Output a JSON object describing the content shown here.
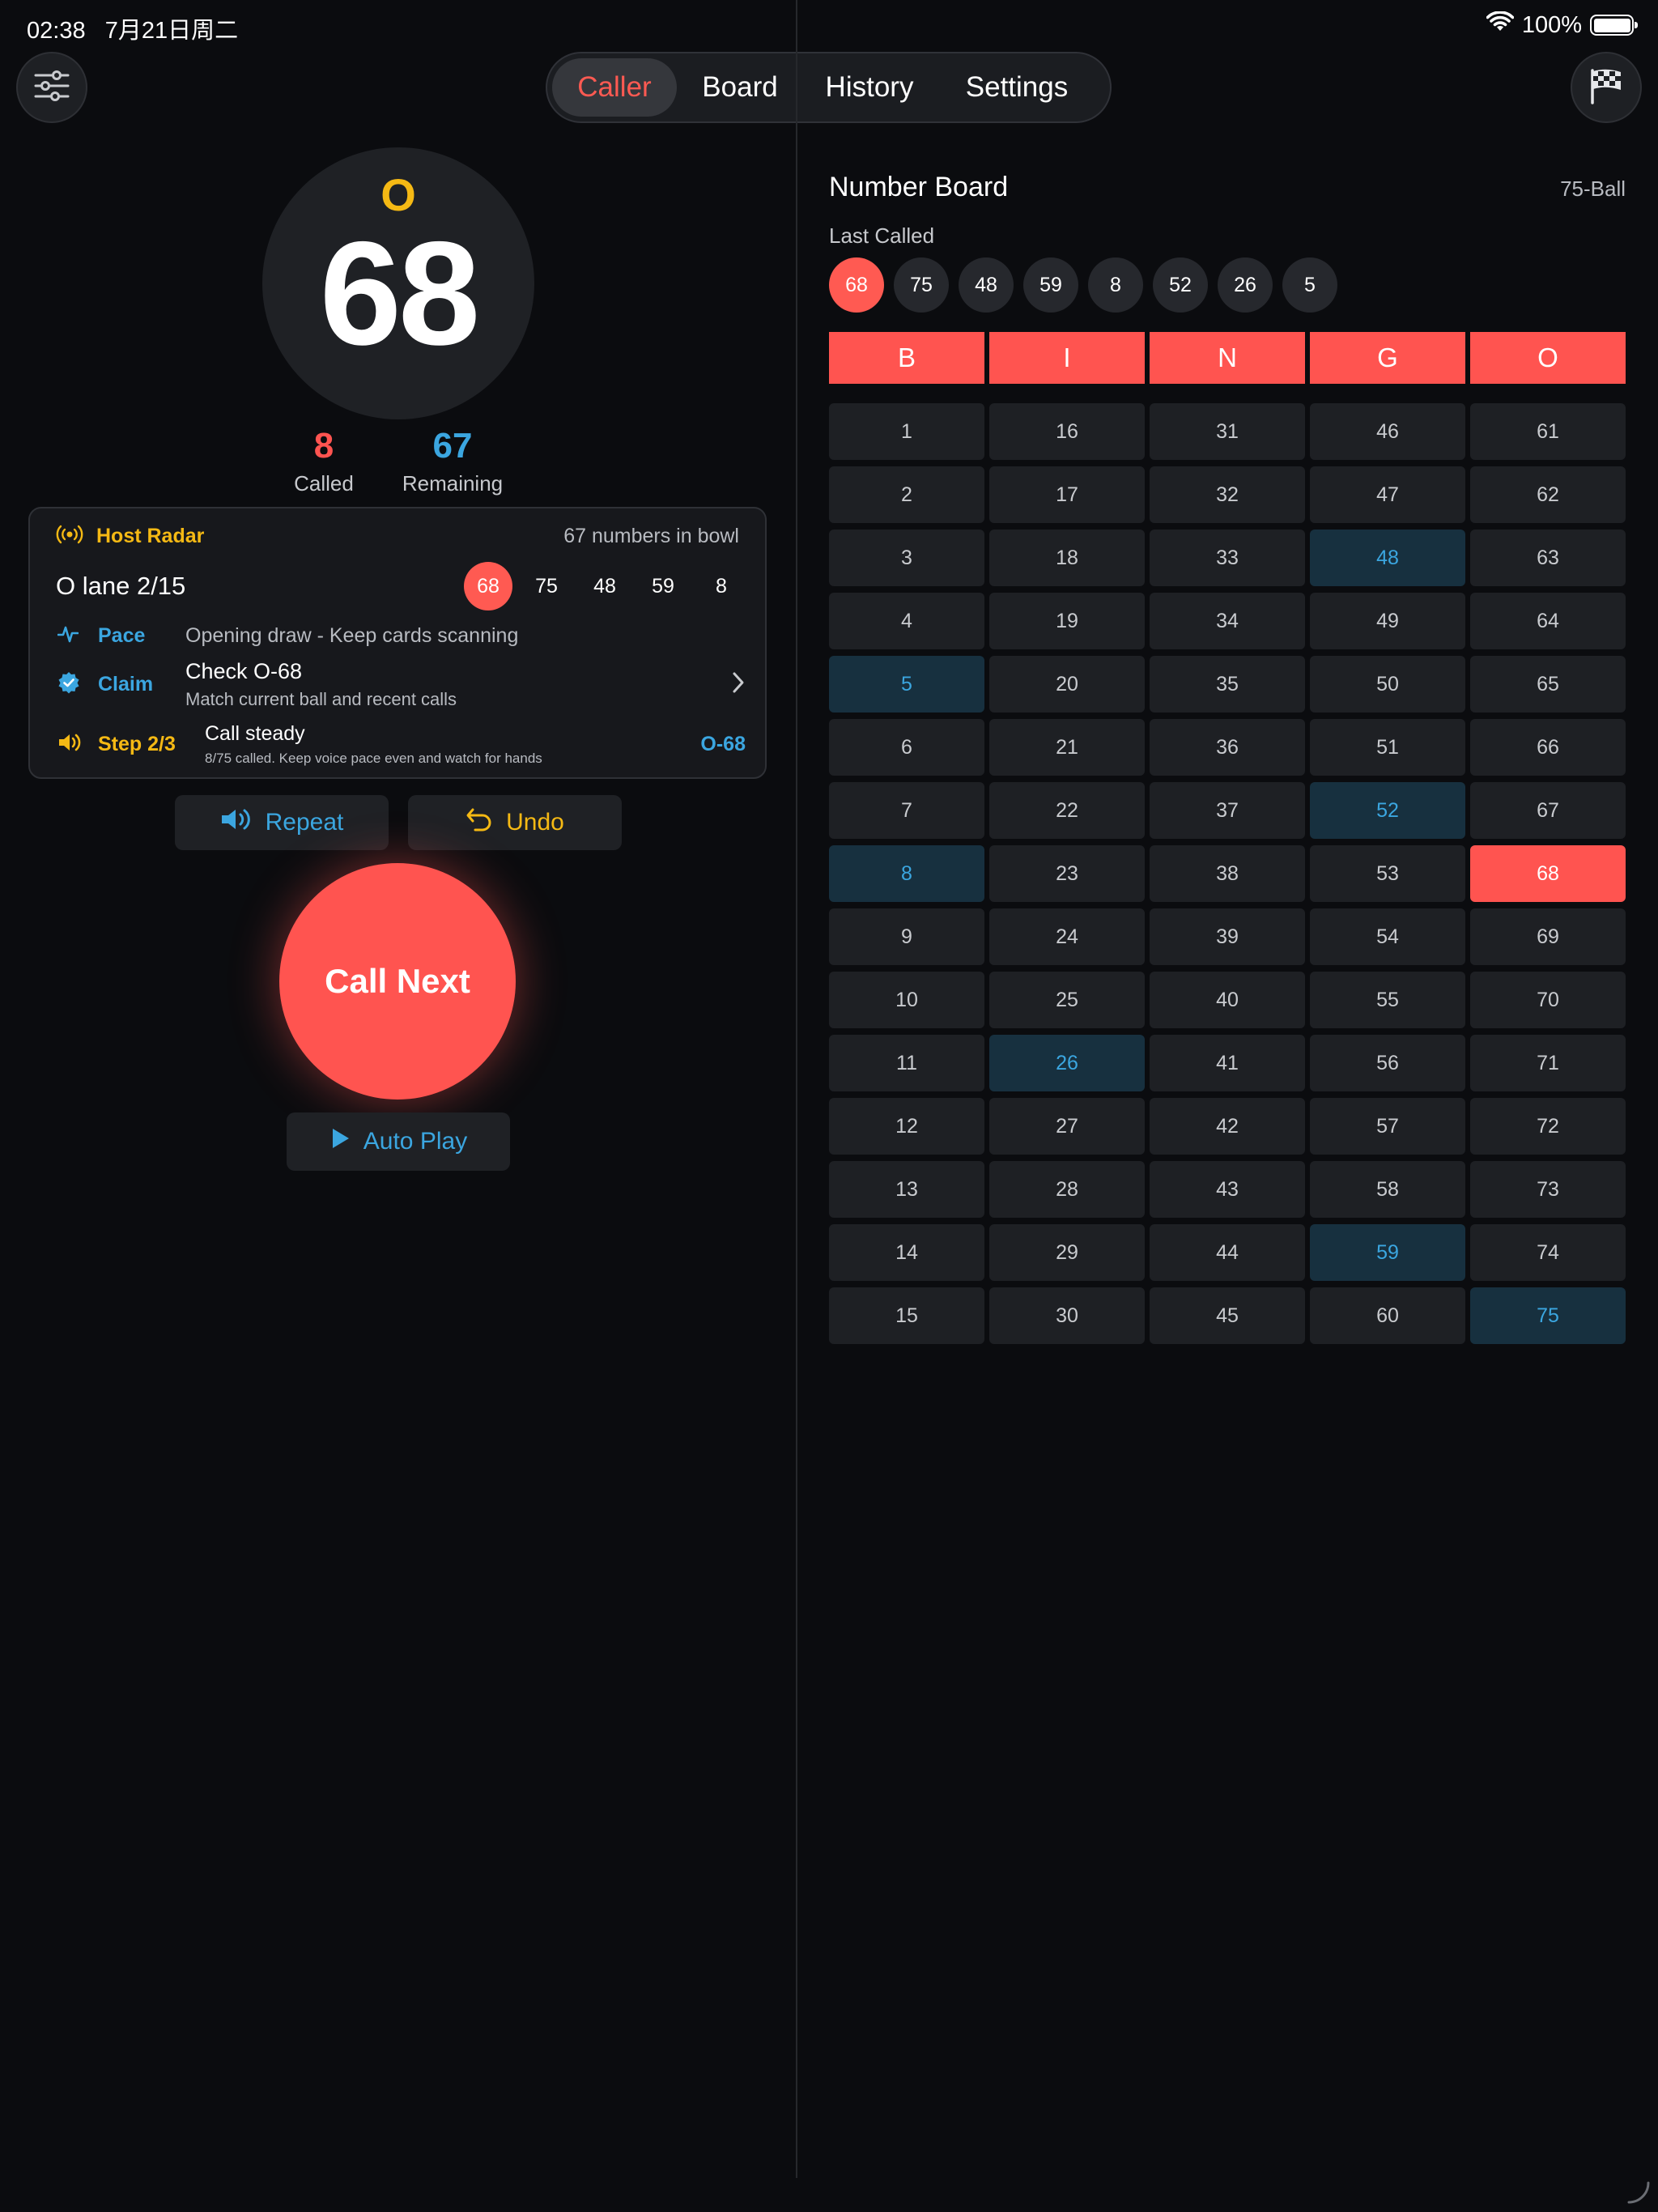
{
  "status_bar": {
    "time": "02:38",
    "date": "7月21日周二",
    "battery": "100%",
    "battery_level": 1.0
  },
  "nav": {
    "tabs": [
      "Caller",
      "Board",
      "History",
      "Settings"
    ],
    "active": "Caller"
  },
  "caller": {
    "letter": "O",
    "number": "68",
    "called_count": "8",
    "called_label": "Called",
    "remaining_count": "67",
    "remaining_label": "Remaining"
  },
  "radar": {
    "title": "Host Radar",
    "bowl": "67 numbers in bowl",
    "lane": "O lane 2/15",
    "recent": [
      "68",
      "75",
      "48",
      "59",
      "8"
    ],
    "pace_label": "Pace",
    "pace_text": "Opening draw - Keep cards scanning",
    "claim_label": "Claim",
    "claim_title": "Check O-68",
    "claim_sub": "Match current ball and recent calls",
    "step_label": "Step 2/3",
    "step_title": "Call steady",
    "step_sub": "8/75 called. Keep voice pace even and watch for hands",
    "step_ball": "O-68"
  },
  "actions": {
    "repeat": "Repeat",
    "undo": "Undo",
    "call_next": "Call Next",
    "auto_play": "Auto Play"
  },
  "board": {
    "title": "Number Board",
    "type": "75-Ball",
    "last_called_label": "Last Called",
    "last_called": [
      "68",
      "75",
      "48",
      "59",
      "8",
      "52",
      "26",
      "5"
    ],
    "headers": [
      "B",
      "I",
      "N",
      "G",
      "O"
    ],
    "columns": [
      [
        "1",
        "2",
        "3",
        "4",
        "5",
        "6",
        "7",
        "8",
        "9",
        "10",
        "11",
        "12",
        "13",
        "14",
        "15"
      ],
      [
        "16",
        "17",
        "18",
        "19",
        "20",
        "21",
        "22",
        "23",
        "24",
        "25",
        "26",
        "27",
        "28",
        "29",
        "30"
      ],
      [
        "31",
        "32",
        "33",
        "34",
        "35",
        "36",
        "37",
        "38",
        "39",
        "40",
        "41",
        "42",
        "43",
        "44",
        "45"
      ],
      [
        "46",
        "47",
        "48",
        "49",
        "50",
        "51",
        "52",
        "53",
        "54",
        "55",
        "56",
        "57",
        "58",
        "59",
        "60"
      ],
      [
        "61",
        "62",
        "63",
        "64",
        "65",
        "66",
        "67",
        "68",
        "69",
        "70",
        "71",
        "72",
        "73",
        "74",
        "75"
      ]
    ],
    "called": [
      "5",
      "8",
      "26",
      "48",
      "52",
      "59",
      "75"
    ],
    "current": "68"
  },
  "colors": {
    "accent": "#ff5450",
    "called": "#3ba6e0",
    "warn": "#f5b914",
    "bg": "#0b0c0f"
  }
}
